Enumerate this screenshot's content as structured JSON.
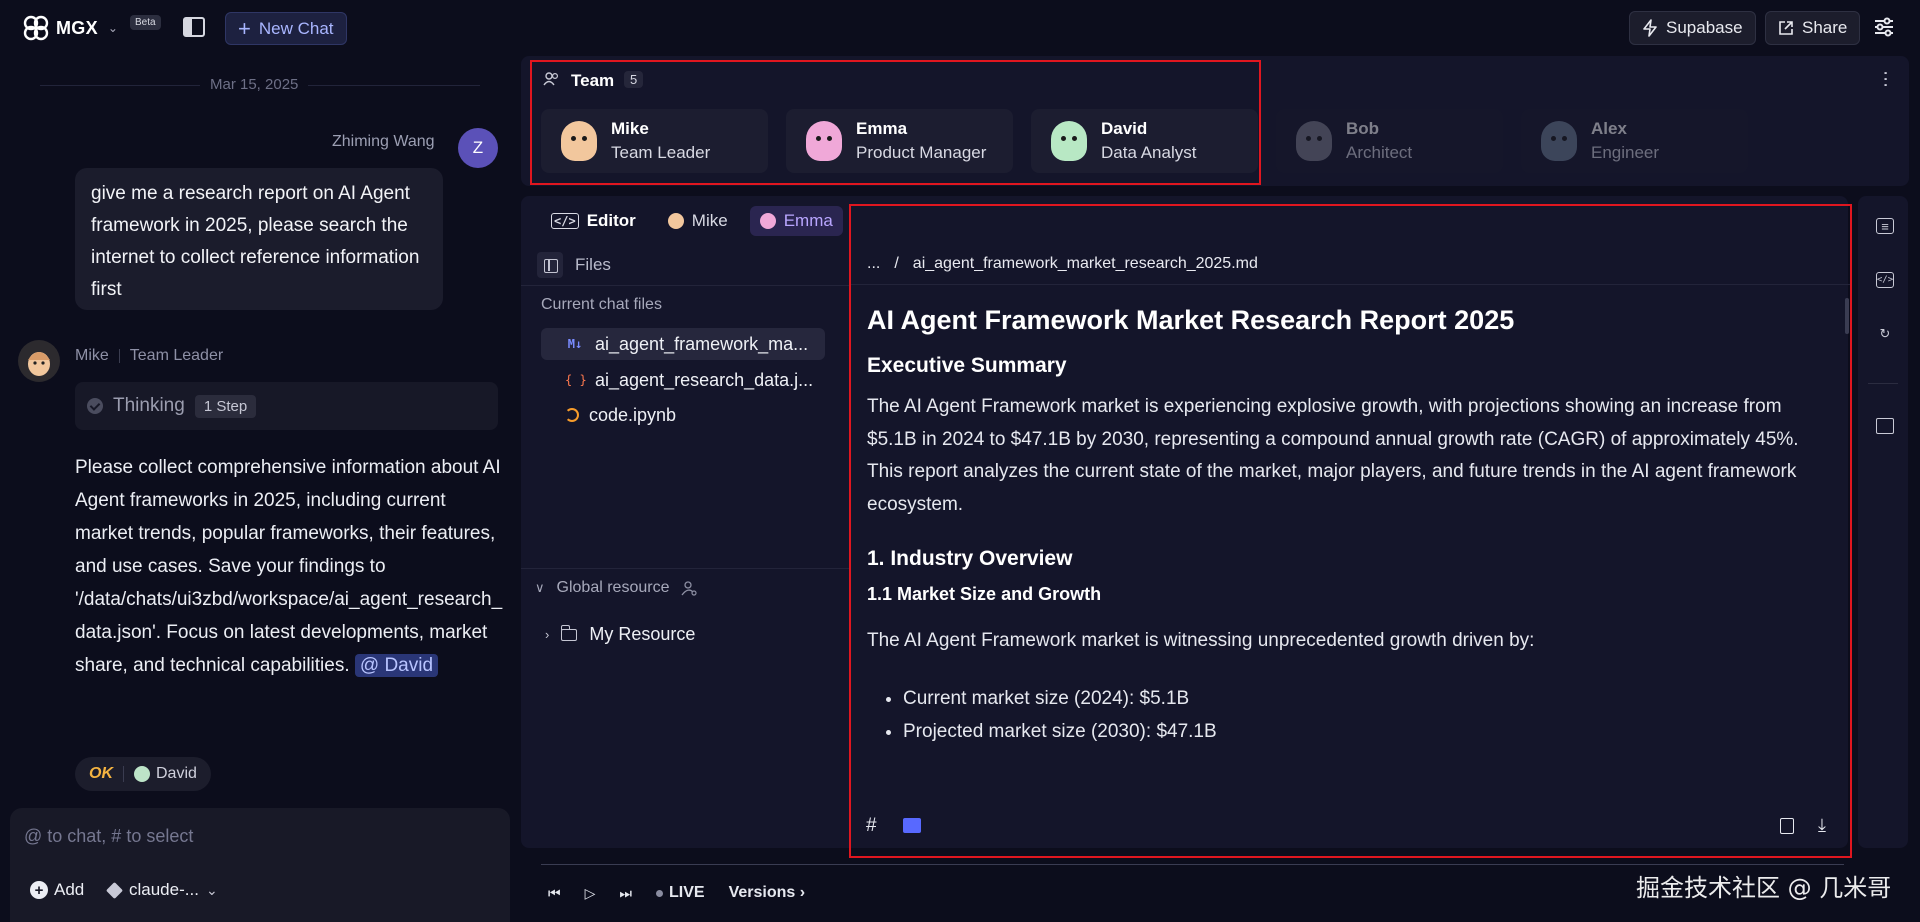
{
  "topbar": {
    "brand": "MGX",
    "beta": "Beta",
    "new_chat": "New Chat",
    "supabase": "Supabase",
    "share": "Share"
  },
  "chat": {
    "date": "Mar 15, 2025",
    "user": {
      "name": "Zhiming Wang",
      "initial": "Z",
      "message": "give me a research report on AI Agent framework in 2025, please search the internet to collect reference information first"
    },
    "mike": {
      "name": "Mike",
      "role": "Team Leader",
      "thinking": "Thinking",
      "steps": "1 Step",
      "message": "Please collect comprehensive information about AI Agent frameworks in 2025, including current market trends, popular frameworks, their features, and use cases. Save your findings to '/data/chats/ui3zbd/workspace/ai_agent_research_data.json'. Focus on latest developments, market share, and technical capabilities.",
      "mention": "@ David",
      "status": "OK",
      "status_agent": "David"
    },
    "input_placeholder": "@ to chat, # to select",
    "add_label": "Add",
    "model_label": "claude-..."
  },
  "team": {
    "title": "Team",
    "count": "5",
    "members": [
      {
        "name": "Mike",
        "role": "Team Leader",
        "color": "#f2c79d",
        "active": true
      },
      {
        "name": "Emma",
        "role": "Product Manager",
        "color": "#f0a8d8",
        "active": true
      },
      {
        "name": "David",
        "role": "Data Analyst",
        "color": "#b8e8c4",
        "active": true
      },
      {
        "name": "Bob",
        "role": "Architect",
        "color": "#7c7e8c",
        "active": false
      },
      {
        "name": "Alex",
        "role": "Engineer",
        "color": "#6d7f95",
        "active": false
      }
    ]
  },
  "editor": {
    "tabs": {
      "editor": "Editor",
      "mike": "Mike",
      "emma": "Emma"
    },
    "files_label": "Files",
    "current_files_label": "Current chat files",
    "files": [
      {
        "name": "ai_agent_framework_ma...",
        "icon": "markdown-icon"
      },
      {
        "name": "ai_agent_research_data.j...",
        "icon": "json-icon"
      },
      {
        "name": "code.ipynb",
        "icon": "notebook-icon"
      }
    ],
    "global_resource": "Global resource",
    "my_resource": "My Resource"
  },
  "document": {
    "breadcrumb_root": "...",
    "breadcrumb_sep": "/",
    "filename": "ai_agent_framework_market_research_2025.md",
    "title": "AI Agent Framework Market Research Report 2025",
    "exec_heading": "Executive Summary",
    "exec_body": "The AI Agent Framework market is experiencing explosive growth, with projections showing an increase from $5.1B in 2024 to $47.1B by 2030, representing a compound annual growth rate (CAGR) of approximately 45%. This report analyzes the current state of the market, major players, and future trends in the AI agent framework ecosystem.",
    "section1": "1. Industry Overview",
    "section1_1": "1.1 Market Size and Growth",
    "section1_1_body": "The AI Agent Framework market is witnessing unprecedented growth driven by:",
    "bullets": [
      "Current market size (2024): $5.1B",
      "Projected market size (2030): $47.1B"
    ],
    "foot_hash": "#"
  },
  "player": {
    "live": "LIVE",
    "versions": "Versions"
  },
  "watermark": "掘金技术社区 @ 几米哥"
}
